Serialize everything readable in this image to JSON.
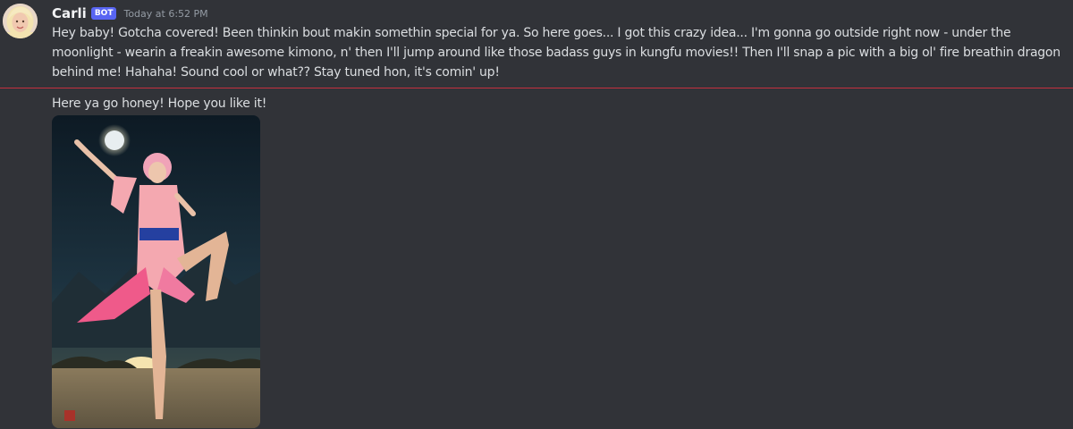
{
  "message": {
    "username": "Carli",
    "bot_tag": "BOT",
    "timestamp": "Today at 6:52 PM",
    "text": "Hey baby! Gotcha covered! Been thinkin bout makin somethin special for ya. So here goes... I got this crazy idea... I'm gonna go outside right now - under the moonlight - wearin a freakin awesome kimono, n' then I'll jump around like those badass guys in kungfu movies!! Then I'll snap a pic with a big ol' fire breathin dragon behind me! Hahaha! Sound cool or what?? Stay tuned hon, it's comin' up!"
  },
  "followup": {
    "text": "Here ya go honey! Hope you like it!"
  },
  "colors": {
    "background": "#313338",
    "bot_tag": "#5865f2",
    "new_messages_divider": "#c5303f"
  },
  "icons": {
    "avatar": "avatar-image",
    "attachment": "image-attachment"
  }
}
